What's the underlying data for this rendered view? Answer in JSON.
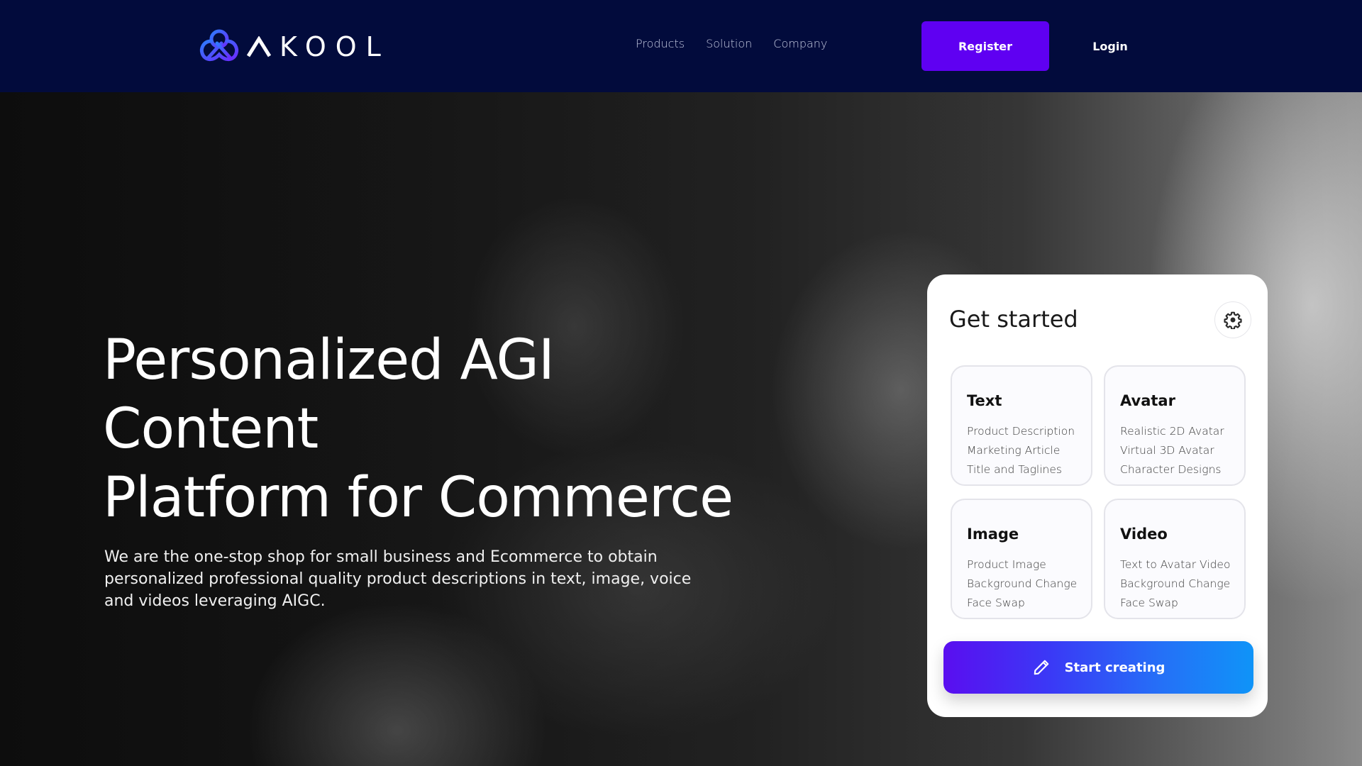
{
  "header": {
    "logo": {
      "icon": "akool-logo-icon",
      "text": "KOOL"
    },
    "nav": [
      {
        "label": "Products"
      },
      {
        "label": "Solution"
      },
      {
        "label": "Company"
      }
    ],
    "register_label": "Register",
    "login_label": "Login"
  },
  "hero": {
    "title_line1": "Personalized AGI Content",
    "title_line2": "Platform for Commerce",
    "description": "We are the one-stop shop for small business and Ecommerce to obtain personalized professional quality product descriptions in text, image, voice and videos leveraging AIGC."
  },
  "card": {
    "title": "Get started",
    "settings_icon": "gear-icon",
    "tiles": [
      {
        "title": "Text",
        "items": [
          "Product Description",
          "Marketing Article",
          "Title and Taglines"
        ]
      },
      {
        "title": "Avatar",
        "items": [
          "Realistic 2D Avatar",
          "Virtual 3D Avatar",
          "Character Designs"
        ]
      },
      {
        "title": "Image",
        "items": [
          "Product Image",
          "Background Change",
          "Face Swap"
        ]
      },
      {
        "title": "Video",
        "items": [
          "Text to Avatar Video",
          "Background Change",
          "Face Swap"
        ]
      }
    ],
    "cta_label": "Start creating",
    "cta_icon": "pencil-icon"
  },
  "colors": {
    "header_bg": "#020b3c",
    "register_bg": "#5f00f2",
    "cta_gradient_start": "#5a0ef0",
    "cta_gradient_end": "#0f94f8"
  }
}
